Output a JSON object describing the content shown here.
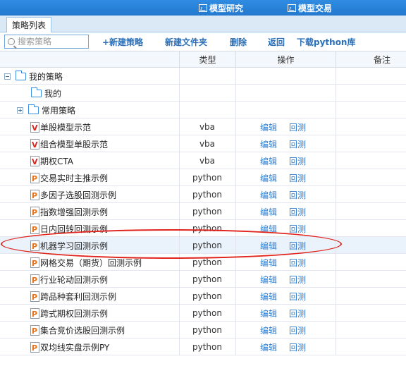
{
  "topbar": {
    "buttons": [
      {
        "label": "模型研究",
        "icon": "chart-icon"
      },
      {
        "label": "模型交易",
        "icon": "chart-icon"
      }
    ]
  },
  "tab": {
    "label": "策略列表"
  },
  "toolbar": {
    "search_placeholder": "搜索策略",
    "new_strategy": "+新建策略",
    "new_folder": "新建文件夹",
    "delete": "删除",
    "back": "返回",
    "download": "下载python库"
  },
  "table": {
    "headers": {
      "name": "",
      "type": "类型",
      "action": "操作",
      "note": "备注"
    },
    "folders": [
      {
        "label": "我的策略",
        "expander": "minus"
      },
      {
        "label": "我的",
        "expander": "none"
      },
      {
        "label": "常用策略",
        "expander": "plus"
      }
    ],
    "strategies": [
      {
        "badge": "V",
        "name": "单股模型示范",
        "type": "vba",
        "edit": "编辑",
        "backtest": "回测"
      },
      {
        "badge": "V",
        "name": "组合模型单股示范",
        "type": "vba",
        "edit": "编辑",
        "backtest": "回测"
      },
      {
        "badge": "V",
        "name": "期权CTA",
        "type": "vba",
        "edit": "编辑",
        "backtest": "回测"
      },
      {
        "badge": "P",
        "name": "交易实时主推示例",
        "type": "python",
        "edit": "编辑",
        "backtest": "回测"
      },
      {
        "badge": "P",
        "name": "多因子选股回测示例",
        "type": "python",
        "edit": "编辑",
        "backtest": "回测"
      },
      {
        "badge": "P",
        "name": "指数增强回测示例",
        "type": "python",
        "edit": "编辑",
        "backtest": "回测"
      },
      {
        "badge": "P",
        "name": "日内回转回测示例",
        "type": "python",
        "edit": "编辑",
        "backtest": "回测"
      },
      {
        "badge": "P",
        "name": "机器学习回测示例",
        "type": "python",
        "edit": "编辑",
        "backtest": "回测",
        "selected": true
      },
      {
        "badge": "P",
        "name": "网格交易（期货）回测示例",
        "type": "python",
        "edit": "编辑",
        "backtest": "回测"
      },
      {
        "badge": "P",
        "name": "行业轮动回测示例",
        "type": "python",
        "edit": "编辑",
        "backtest": "回测"
      },
      {
        "badge": "P",
        "name": "跨品种套利回测示例",
        "type": "python",
        "edit": "编辑",
        "backtest": "回测"
      },
      {
        "badge": "P",
        "name": "跨式期权回测示例",
        "type": "python",
        "edit": "编辑",
        "backtest": "回测"
      },
      {
        "badge": "P",
        "name": "集合竞价选股回测示例",
        "type": "python",
        "edit": "编辑",
        "backtest": "回测"
      },
      {
        "badge": "P",
        "name": "双均线实盘示例PY",
        "type": "python",
        "edit": "编辑",
        "backtest": "回测"
      }
    ]
  },
  "annotation": {
    "color": "#e0231c",
    "shape": "ellipse"
  }
}
